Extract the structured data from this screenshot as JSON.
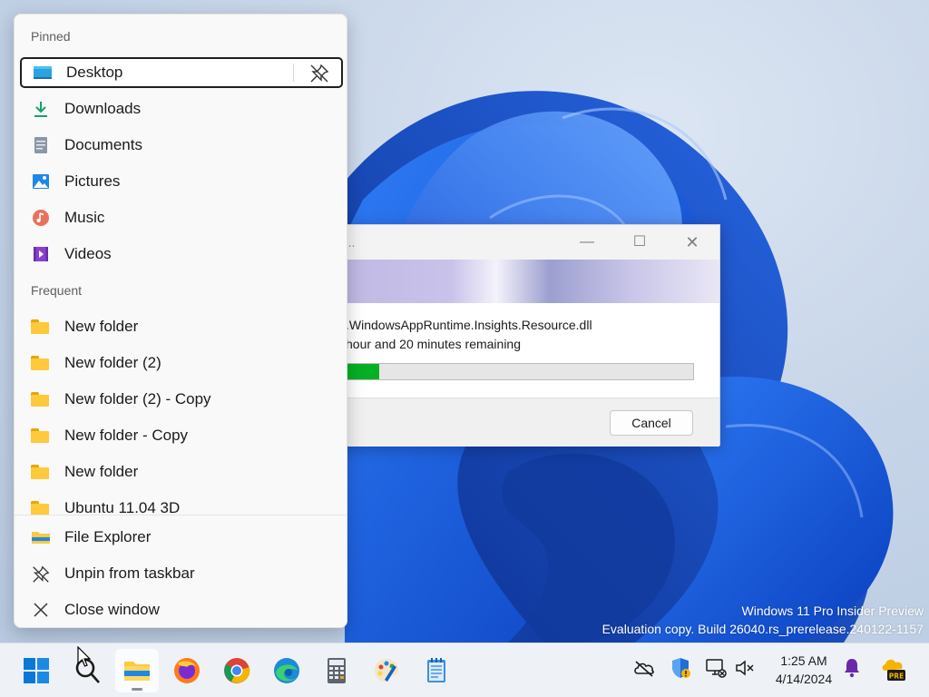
{
  "watermark": {
    "line1": "Windows 11 Pro Insider Preview",
    "line2": "Evaluation copy. Build 26040.rs_prerelease.240122-1157"
  },
  "dialog": {
    "title_fragment": "ssing...",
    "file_name_fragment": ".WindowsAppRuntime.Insights.Resource.dll",
    "remaining_fragment": "hour and 20 minutes remaining",
    "progress_fraction": 0.1,
    "cancel_label": "Cancel",
    "minimize_glyph": "—",
    "maximize_glyph": "☐",
    "close_glyph": "✕"
  },
  "jumplist": {
    "pinned_label": "Pinned",
    "pinned": [
      {
        "label": "Desktop",
        "icon": "desktop-icon"
      },
      {
        "label": "Downloads",
        "icon": "downloads-icon"
      },
      {
        "label": "Documents",
        "icon": "documents-icon"
      },
      {
        "label": "Pictures",
        "icon": "pictures-icon"
      },
      {
        "label": "Music",
        "icon": "music-icon"
      },
      {
        "label": "Videos",
        "icon": "videos-icon"
      }
    ],
    "frequent_label": "Frequent",
    "frequent": [
      {
        "label": "New folder",
        "icon": "folder-icon"
      },
      {
        "label": "New folder (2)",
        "icon": "folder-icon"
      },
      {
        "label": "New folder (2) - Copy",
        "icon": "folder-icon"
      },
      {
        "label": "New folder - Copy",
        "icon": "folder-icon"
      },
      {
        "label": "New folder",
        "icon": "folder-icon"
      },
      {
        "label": "Ubuntu 11.04 3D",
        "icon": "folder-icon"
      }
    ],
    "actions": [
      {
        "label": "File Explorer",
        "icon": "file-explorer-icon"
      },
      {
        "label": "Unpin from taskbar",
        "icon": "unpin-icon"
      },
      {
        "label": "Close window",
        "icon": "close-icon"
      }
    ]
  },
  "taskbar": {
    "apps": [
      "start-icon",
      "search-icon",
      "file-explorer-icon",
      "firefox-icon",
      "chrome-icon",
      "edge-icon",
      "calculator-icon",
      "paint-icon",
      "notepad-icon"
    ],
    "tray_icons": [
      "onedrive-icon",
      "security-icon",
      "network-icon",
      "volume-muted-icon"
    ],
    "time": "1:25 AM",
    "date": "4/14/2024",
    "colors": {
      "accent": "#0067c0",
      "progress": "#06b025",
      "folder": "#ffc93c"
    }
  }
}
